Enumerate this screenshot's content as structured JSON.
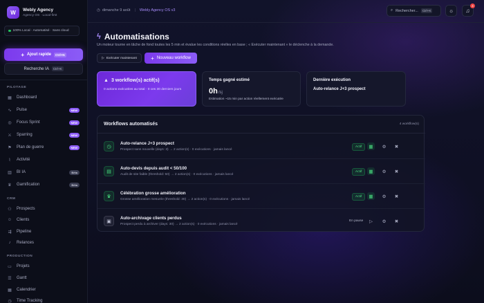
{
  "brand": {
    "name": "Webly Agency",
    "subtitle": "Agency OS · Local-first",
    "logo": "W"
  },
  "local_badge": "100% Local · Automatisé · Sans cloud",
  "quick_add": {
    "label": "Ajout rapide",
    "shortcut": "Ctrl+N"
  },
  "ai_search": {
    "label": "Recherche IA",
    "shortcut": "Ctrl+K"
  },
  "sections": {
    "pilotage": "PILOTAGE",
    "crm": "CRM",
    "production": "PRODUCTION"
  },
  "nav": {
    "dashboard": "Dashboard",
    "pulse": "Pulse",
    "focus": "Focus Sprint",
    "sparring": "Sparring",
    "plan": "Plan de guerre",
    "activite": "Activité",
    "bi": "BI IA",
    "gamification": "Gamification",
    "prospects": "Prospects",
    "clients": "Clients",
    "pipeline": "Pipeline",
    "relances": "Relances",
    "projets": "Projets",
    "gantt": "Gantt",
    "calendrier": "Calendrier",
    "time": "Time Tracking"
  },
  "badges": {
    "new": "NEW",
    "beta": "Bêta"
  },
  "topbar": {
    "date": "dimanche 9 août",
    "crumb": "Webly Agency OS v3",
    "search": "Rechercher...",
    "search_shortcut": "Ctrl+K",
    "notifications": "4"
  },
  "page": {
    "title": "Automatisations",
    "subtitle": "Un moteur tourne en tâche de fond toutes les 5 min et évalue les conditions réelles en base ; « Exécuter maintenant » le déclenche à la demande.",
    "run_now": "Exécuter maintenant",
    "new_workflow": "Nouveau workflow"
  },
  "cards": {
    "active": {
      "title": "3 workflow(s) actif(s)",
      "line": "0 actions exécutées au total · 0 ces 30 derniers jours"
    },
    "time": {
      "title": "Temps gagné estimé",
      "value": "0h",
      "unit": "/sj",
      "line": "Estimation ~15 min par action réellement exécutée"
    },
    "last": {
      "title": "Dernière exécution",
      "value": "Auto-relance J+3 prospect"
    }
  },
  "workflows": {
    "title": "Workflows automatisés",
    "count": "4 workflow(s)",
    "rows": [
      {
        "name": "Auto-relance J+3 prospect",
        "desc": "Prospect sans nouvelle (days: 3) → 2 action(s) · 0 exécutions · jamais lancé",
        "status": "Actif"
      },
      {
        "name": "Auto-devis depuis audit < 50/100",
        "desc": "Audit de site faible (threshold: 50) → 2 action(s) · 0 exécutions · jamais lancé",
        "status": "Actif"
      },
      {
        "name": "Célébration grosse amélioration",
        "desc": "Grosse amélioration mesurée (threshold: 30) → 2 action(s) · 0 exécutions · jamais lancé",
        "status": "Actif"
      },
      {
        "name": "Auto-archivage clients perdus",
        "desc": "Prospect perdu à archiver (days: 30) → 2 action(s) · 0 exécutions · jamais lancé",
        "status": "En pause"
      }
    ]
  },
  "colors": {
    "accent": "#8b5cf6",
    "active": "#4ade80",
    "bg": "#0b0d18"
  }
}
